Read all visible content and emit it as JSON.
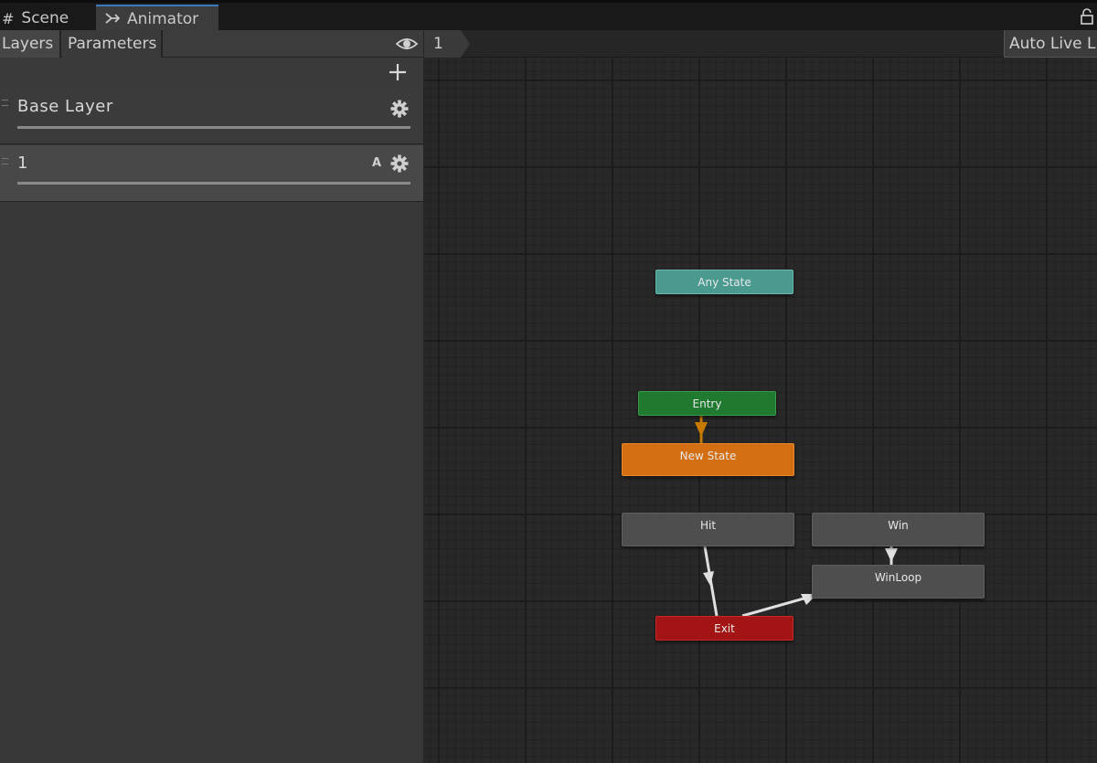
{
  "tabs": {
    "scene": {
      "label": "Scene",
      "icon": "grid-icon"
    },
    "animator": {
      "label": "Animator",
      "icon": "animator-icon"
    }
  },
  "layers_panel": {
    "tabs": [
      "Layers",
      "Parameters"
    ],
    "layers": [
      {
        "name": "Base Layer",
        "additive_badge": ""
      },
      {
        "name": "1",
        "additive_badge": "A"
      }
    ]
  },
  "graph": {
    "breadcrumb": "1",
    "auto_live_label": "Auto Live L",
    "states": {
      "any_state": "Any State",
      "entry": "Entry",
      "new_state": "New State",
      "hit": "Hit",
      "win": "Win",
      "winloop": "WinLoop",
      "exit": "Exit"
    },
    "colors": {
      "any_state": "#4a9a90",
      "entry": "#1f7a2f",
      "default_state": "#d46e12",
      "state": "#4e4e4e",
      "exit": "#a31515",
      "default_transition": "#c87a00",
      "transition": "#e0e0e0"
    }
  }
}
